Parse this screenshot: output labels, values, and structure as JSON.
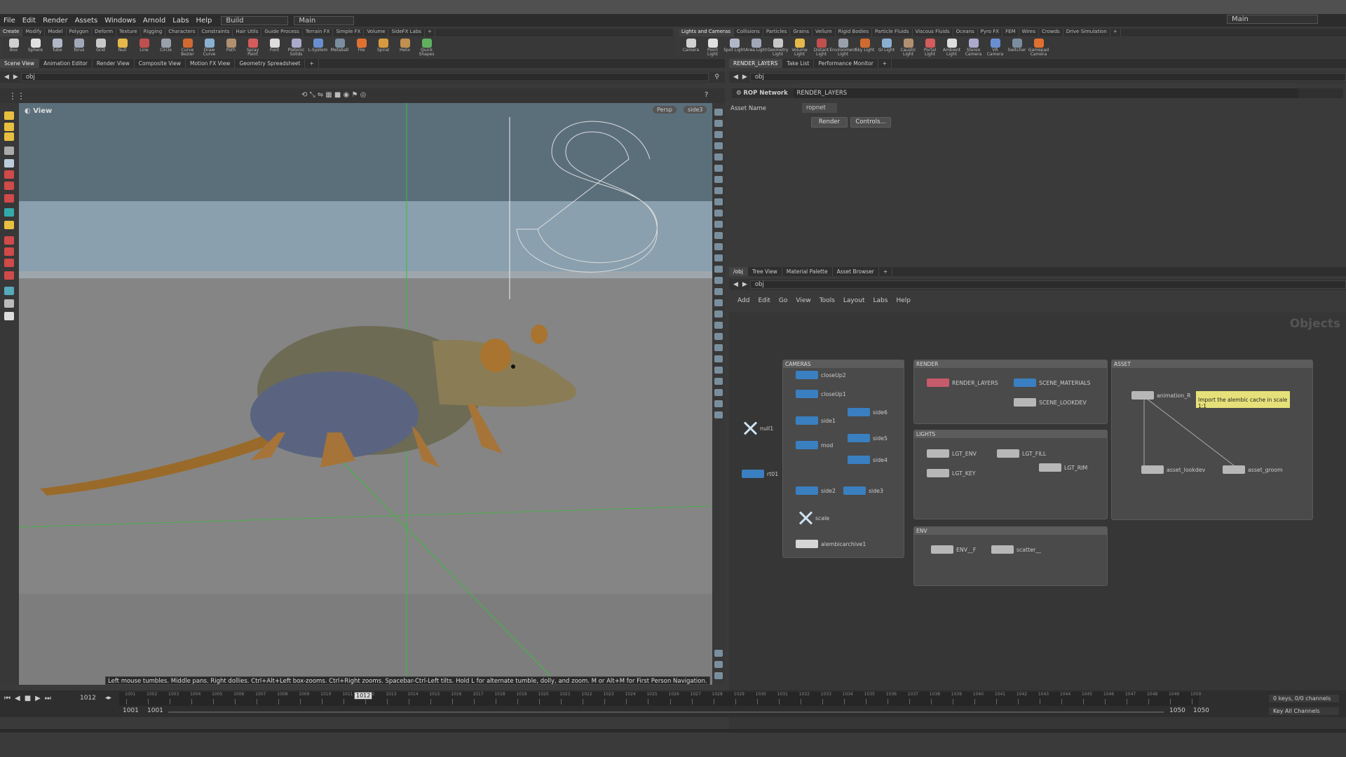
{
  "menubar": {
    "items": [
      "File",
      "Edit",
      "Render",
      "Assets",
      "Windows",
      "Arnold",
      "Labs",
      "Help"
    ],
    "desktop": "Build",
    "main_left": "Main",
    "main_right": "Main"
  },
  "shelf_left": {
    "tabs": [
      "Create",
      "Modify",
      "Model",
      "Polygon",
      "Deform",
      "Texture",
      "Rigging",
      "Characters",
      "Constraints",
      "Hair Utils",
      "Guide Process",
      "Terrain FX",
      "Simple FX",
      "Volume",
      "SideFX Labs"
    ],
    "tools": [
      "Box",
      "Sphere",
      "Tube",
      "Torus",
      "Grid",
      "Null",
      "Line",
      "Circle",
      "Curve Bezier",
      "Draw Curve",
      "Path",
      "Spray Paint",
      "Font",
      "Platonic Solids",
      "L-System",
      "Metaball",
      "File",
      "Spiral",
      "Helix",
      "Quick Shapes"
    ]
  },
  "shelf_right": {
    "tabs": [
      "Lights and Cameras",
      "Collisions",
      "Particles",
      "Grains",
      "Vellum",
      "Rigid Bodies",
      "Particle Fluids",
      "Viscous Fluids",
      "Oceans",
      "Pyro FX",
      "FEM",
      "Wires",
      "Crowds",
      "Drive Simulation"
    ],
    "tools": [
      "Camera",
      "Point Light",
      "Spot Light",
      "Area Light",
      "Geometry Light",
      "Volume Light",
      "Distant Light",
      "Environment Light",
      "Sky Light",
      "GI Light",
      "Caustic Light",
      "Portal Light",
      "Ambient Light",
      "Stereo Camera",
      "VR Camera",
      "Switcher",
      "Gamepad Camera"
    ]
  },
  "left_tabs": [
    "Scene View",
    "Animation Editor",
    "Render View",
    "Composite View",
    "Motion FX View",
    "Geometry Spreadsheet"
  ],
  "left_path": "obj",
  "viewport": {
    "label": "View",
    "persp": "Persp",
    "cam": "side3",
    "status": "Left mouse tumbles. Middle pans. Right dollies. Ctrl+Alt+Left box-zooms. Ctrl+Right zooms. Spacebar-Ctrl-Left tilts. Hold L for alternate tumble, dolly, and zoom. M or Alt+M for First Person Navigation."
  },
  "right_top_tabs": [
    "RENDER_LAYERS",
    "Take List",
    "Performance Monitor"
  ],
  "right_top_path": "obj",
  "rop": {
    "type": "ROP Network",
    "name": "RENDER_LAYERS",
    "asset_label": "Asset Name",
    "asset_value": "ropnet",
    "render_btn": "Render",
    "controls_btn": "Controls..."
  },
  "right_bottom_tabs": [
    "/obj",
    "Tree View",
    "Material Palette",
    "Asset Browser"
  ],
  "right_bottom_path": "obj",
  "net_menu": [
    "Add",
    "Edit",
    "Go",
    "View",
    "Tools",
    "Layout",
    "Labs",
    "Help"
  ],
  "net_title": "Objects",
  "boxes": {
    "cameras": "CAMERAS",
    "render": "RENDER",
    "asset": "ASSET",
    "lights": "LIGHTS",
    "env": "ENV"
  },
  "nodes": {
    "closeUp2": "closeUp2",
    "closeUp1": "closeUp1",
    "side1": "side1",
    "mod": "mod",
    "side6": "side6",
    "side5": "side5",
    "side4": "side4",
    "side2": "side2",
    "side3": "side3",
    "scale": "scale",
    "alembic": "alembicarchive1",
    "null1": "null1",
    "rt01": "rt01",
    "render_layers": "RENDER_LAYERS",
    "scene_materials": "SCENE_MATERIALS",
    "scene_lookdev": "SCENE_LOOKDEV",
    "lgt_env": "LGT_ENV",
    "lgt_fill": "LGT_FILL",
    "lgt_rim": "LGT_RIM",
    "lgt_key": "LGT_KEY",
    "env_f": "ENV__F",
    "scatter": "scatter__",
    "animation": "animation_R",
    "asset_lookdev": "asset_lookdev",
    "asset_groom": "asset_groom",
    "sticky": "Import the alembic cache in scale 1:1"
  },
  "timeline": {
    "current_frame": "1012",
    "marker": "1012",
    "start": "1001",
    "start2": "1001",
    "end": "1050",
    "end2": "1050",
    "ticks": [
      "1001",
      "1002",
      "1003",
      "1004",
      "1005",
      "1006",
      "1007",
      "1008",
      "1009",
      "1010",
      "1011",
      "1012",
      "1013",
      "1014",
      "1015",
      "1016",
      "1017",
      "1018",
      "1019",
      "1020",
      "1021",
      "1022",
      "1023",
      "1024",
      "1025",
      "1026",
      "1027",
      "1028",
      "1029",
      "1030",
      "1031",
      "1032",
      "1033",
      "1034",
      "1035",
      "1036",
      "1037",
      "1038",
      "1039",
      "1040",
      "1041",
      "1042",
      "1043",
      "1044",
      "1045",
      "1046",
      "1047",
      "1048",
      "1049",
      "1050"
    ],
    "keys": "0 keys, 0/0 channels",
    "key_all": "Key All Channels"
  }
}
